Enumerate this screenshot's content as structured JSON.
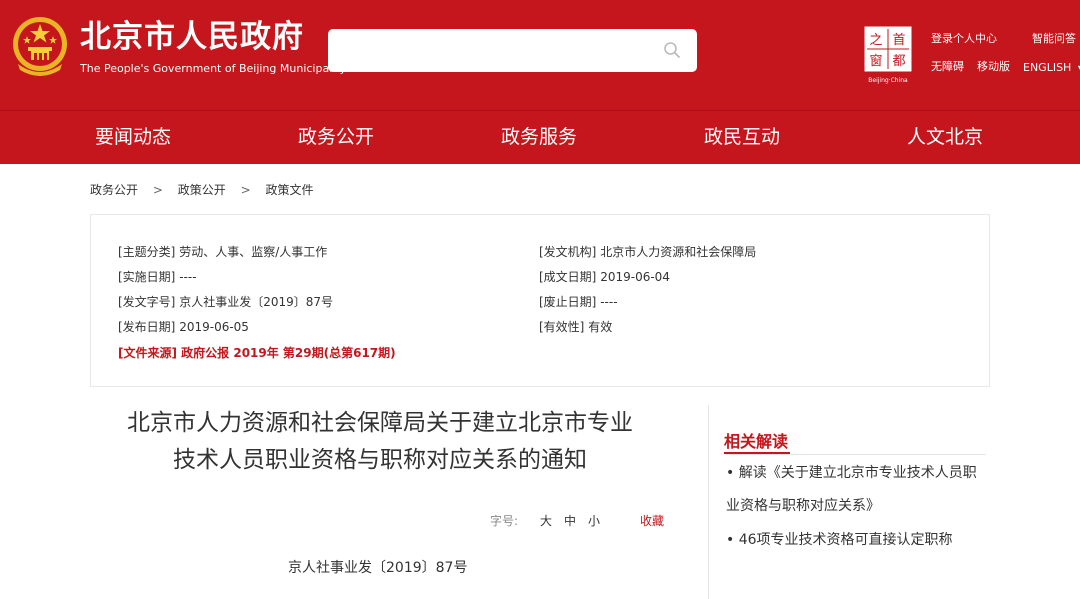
{
  "header": {
    "site_title": "北京市人民政府",
    "site_subtitle": "The People's Government of Beijing Municipality",
    "search_placeholder": "",
    "capital_logo_caption": "Beijing·China",
    "capital_logo_chars": [
      "之",
      "首",
      "窗",
      "都"
    ],
    "links": {
      "login": "登录个人中心",
      "smart_qa": "智能问答",
      "accessibility": "无障碍",
      "mobile": "移动版",
      "english": "ENGLISH"
    }
  },
  "nav": {
    "items": [
      "要闻动态",
      "政务公开",
      "政务服务",
      "政民互动",
      "人文北京"
    ]
  },
  "breadcrumb": [
    "政务公开",
    "政策公开",
    "政策文件"
  ],
  "meta": {
    "left": [
      {
        "label": "[主题分类]",
        "value": "劳动、人事、监察/人事工作"
      },
      {
        "label": "[实施日期]",
        "value": "----"
      },
      {
        "label": "[发文字号]",
        "value": "京人社事业发〔2019〕87号"
      },
      {
        "label": "[发布日期]",
        "value": "2019-06-05"
      }
    ],
    "right": [
      {
        "label": "[发文机构]",
        "value": "北京市人力资源和社会保障局"
      },
      {
        "label": "[成文日期]",
        "value": "2019-06-04"
      },
      {
        "label": "[废止日期]",
        "value": "----"
      },
      {
        "label": "[有效性]",
        "value": "有效"
      }
    ],
    "source": {
      "label": "[文件来源]",
      "value": "政府公报 2019年 第29期(总第617期)"
    }
  },
  "article": {
    "title_line1": "北京市人力资源和社会保障局关于建立北京市专业",
    "title_line2": "技术人员职业资格与职称对应关系的通知",
    "font_size_label": "字号:",
    "font_large": "大",
    "font_medium": "中",
    "font_small": "小",
    "favorite": "收藏",
    "doc_number": "京人社事业发〔2019〕87号"
  },
  "related": {
    "title": "相关解读",
    "items": [
      "• 解读《关于建立北京市专业技术人员职业资格与职称对应关系》",
      "• 46项专业技术资格可直接认定职称"
    ]
  },
  "colors": {
    "brand_red": "#c4161c",
    "text": "#333333",
    "border": "#e8e8e8"
  }
}
